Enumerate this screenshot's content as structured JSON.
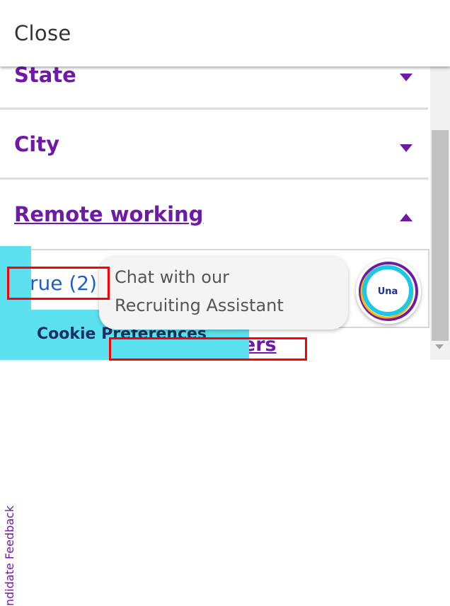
{
  "header": {
    "close_label": "Close"
  },
  "filters": [
    {
      "label": "State",
      "expanded": false
    },
    {
      "label": "City",
      "expanded": false
    },
    {
      "label": "Remote working",
      "expanded": true
    }
  ],
  "remote_working_options": [
    {
      "label": "rue (2)"
    }
  ],
  "filters_link": "ters",
  "feedback_tab": {
    "label": "ndidate Feedback"
  },
  "cookie_tab": {
    "label": "Cookie Preferences"
  },
  "chat_widget": {
    "line1": "Chat with our",
    "line2": "Recruiting Assistant",
    "avatar_label": "Una"
  },
  "colors": {
    "accent": "#6f1aa6",
    "link_blue": "#1f5fc4",
    "cyan_tab": "#5ce1f0",
    "highlight_red": "#ff0000"
  }
}
